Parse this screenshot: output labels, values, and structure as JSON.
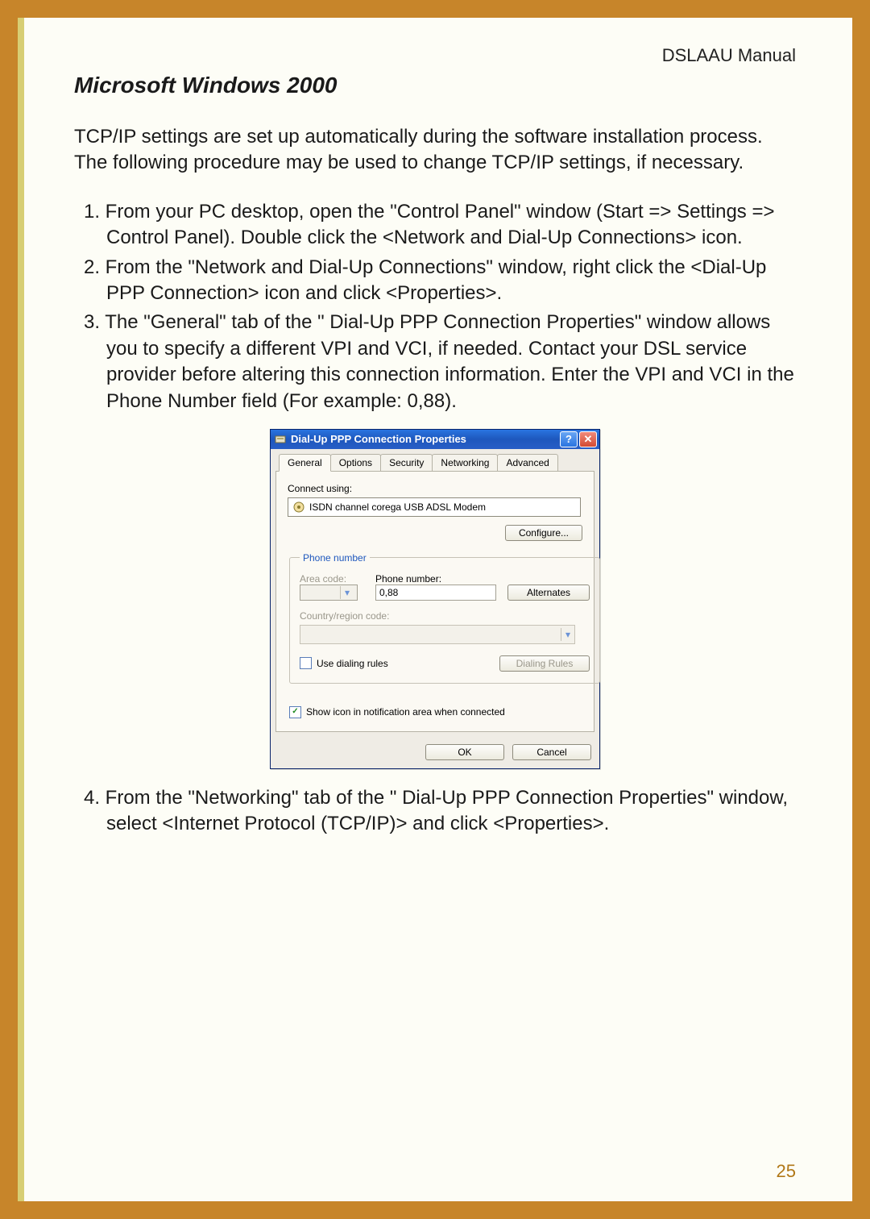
{
  "doc": {
    "header": "DSLAAU Manual",
    "section_title": "Microsoft  Windows 2000",
    "intro": "TCP/IP settings are set up automatically during the software installation process. The following procedure may be used to change TCP/IP settings, if necessary.",
    "steps": {
      "s1": "1.  From your PC desktop, open the \"Control Panel\" window (Start => Settings => Control Panel). Double click the <Network and Dial-Up Connections> icon.",
      "s2": "2.  From the \"Network and Dial-Up Connections\" window, right click the  <Dial-Up PPP Connection> icon and click <Properties>.",
      "s3": "3.  The \"General\" tab of the \" Dial-Up PPP Connection Properties\" window allows you to specify a different VPI and VCI, if needed. Contact your DSL service provider before altering this connection information. Enter the VPI and VCI in the Phone Number field (For example: 0,88).",
      "s4": "4. From the \"Networking\" tab of the \" Dial-Up PPP Connection Properties\" window, select <Internet Protocol (TCP/IP)> and click <Properties>."
    },
    "page_number": "25"
  },
  "dialog": {
    "title": "Dial-Up PPP Connection Properties",
    "help_glyph": "?",
    "close_glyph": "✕",
    "tabs": {
      "general": "General",
      "options": "Options",
      "security": "Security",
      "networking": "Networking",
      "advanced": "Advanced"
    },
    "connect_using_label": "Connect using:",
    "modem_text": "ISDN  channel  corega USB ADSL Modem",
    "configure_btn": "Configure...",
    "phone_group_label": "Phone number",
    "area_code_label": "Area code:",
    "phone_number_label": "Phone number:",
    "phone_number_value": "0,88",
    "alternates_btn": "Alternates",
    "country_label": "Country/region code:",
    "use_dialing_rules_label": "Use dialing rules",
    "dialing_rules_btn": "Dialing Rules",
    "show_icon_label": "Show icon in notification area when connected",
    "ok_btn": "OK",
    "cancel_btn": "Cancel"
  }
}
